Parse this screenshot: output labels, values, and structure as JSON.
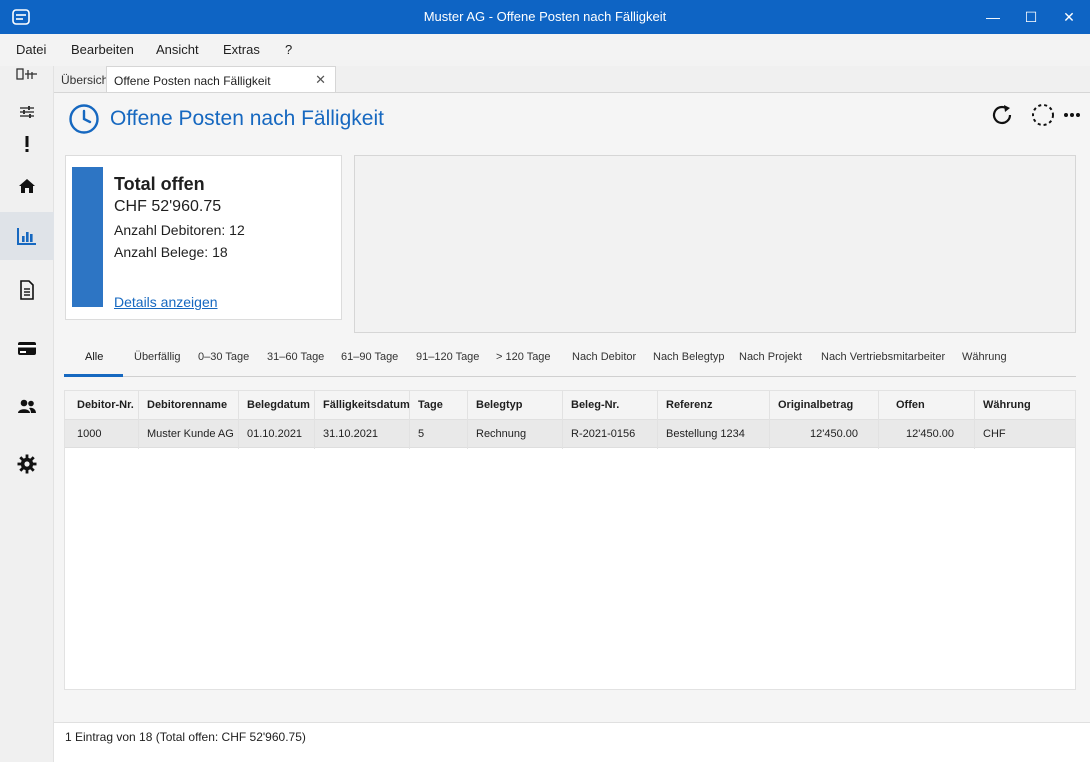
{
  "window": {
    "title": "Muster AG - Offene Posten nach Fälligkeit",
    "minimize": "—",
    "maximize": "☐",
    "close": "✕"
  },
  "menu": [
    "Datei",
    "Bearbeiten",
    "Ansicht",
    "Extras",
    "?"
  ],
  "sidebar": [
    "sliders-icon",
    "alert-icon",
    "home-icon",
    "chart-icon",
    "document-icon",
    "card-icon",
    "users-icon",
    "gear-icon"
  ],
  "tabs": {
    "overview": "Übersicht",
    "current": "Offene Posten nach Fälligkeit",
    "close": "✕"
  },
  "page": {
    "title": "Offene Posten nach Fälligkeit"
  },
  "summary": {
    "heading": "Total offen",
    "amount": "CHF 52'960.75",
    "debtors": "Anzahl Debitoren: 12",
    "documents": "Anzahl Belege: 18",
    "link": "Details anzeigen"
  },
  "filters": [
    "Alle",
    "Überfällig",
    "0–30 Tage",
    "31–60 Tage",
    "61–90 Tage",
    "91–120 Tage",
    "> 120 Tage",
    "Nach Debitor",
    "Nach Belegtyp",
    "Nach Projekt",
    "Nach Vertriebsmitarbeiter",
    "Währung"
  ],
  "table": {
    "columns": [
      "Debitor-Nr.",
      "Debitorenname",
      "Belegdatum",
      "Fälligkeitsdatum",
      "Tage",
      "Belegtyp",
      "Beleg-Nr.",
      "Referenz",
      "Originalbetrag",
      "Offen",
      "Währung"
    ],
    "rows": [
      [
        "1000",
        "Muster Kunde AG",
        "01.10.2021",
        "31.10.2021",
        "5",
        "Rechnung",
        "R-2021-0156",
        "Bestellung 1234",
        "12'450.00",
        "12'450.00",
        "CHF"
      ]
    ]
  },
  "status": "1 Eintrag von 18 (Total offen: CHF 52'960.75)",
  "colors": {
    "accent": "#1668c0",
    "titlebar": "#0e64c4"
  }
}
